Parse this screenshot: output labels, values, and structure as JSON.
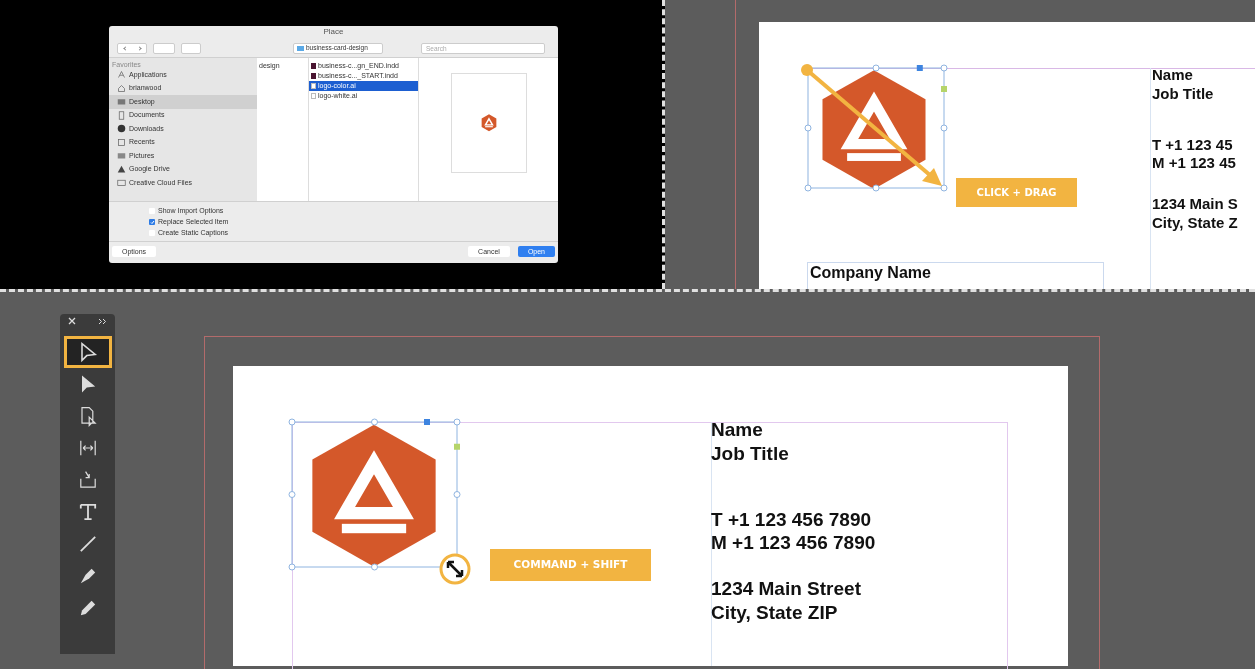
{
  "place_dialog": {
    "title": "Place",
    "location": "business-card-design",
    "search_placeholder": "Search",
    "sidebar": {
      "heading": "Favorites",
      "items": [
        {
          "label": "Applications",
          "selected": false
        },
        {
          "label": "brianwood",
          "selected": false
        },
        {
          "label": "Desktop",
          "selected": true
        },
        {
          "label": "Documents",
          "selected": false
        },
        {
          "label": "Downloads",
          "selected": false
        },
        {
          "label": "Recents",
          "selected": false
        },
        {
          "label": "Pictures",
          "selected": false
        },
        {
          "label": "Google Drive",
          "selected": false
        },
        {
          "label": "Creative Cloud Files",
          "selected": false
        }
      ]
    },
    "folder_column": [
      {
        "label": "design",
        "selected": false
      }
    ],
    "files": [
      {
        "name": "business-c...gn_END.indd",
        "kind": "indd",
        "selected": false
      },
      {
        "name": "business-c..._START.indd",
        "kind": "indd",
        "selected": false
      },
      {
        "name": "logo-color.ai",
        "kind": "ai",
        "selected": true
      },
      {
        "name": "logo-white.ai",
        "kind": "ai",
        "selected": false
      }
    ],
    "options": [
      {
        "label": "Show Import Options",
        "checked": false
      },
      {
        "label": "Replace Selected Item",
        "checked": true
      },
      {
        "label": "Create Static Captions",
        "checked": false
      }
    ],
    "options_button": "Options",
    "buttons": [
      {
        "label": "Cancel",
        "kind": "secondary"
      },
      {
        "label": "Open",
        "kind": "primary"
      }
    ]
  },
  "top_document": {
    "callout": "CLICK + DRAG",
    "text_groups": [
      [
        "Name",
        "Job Title"
      ],
      [
        "T +1 123 45",
        "M +1 123 45"
      ],
      [
        "1234 Main S",
        "City, State Z"
      ]
    ],
    "company": "Company Name"
  },
  "tools_panel": {
    "tools": [
      {
        "kind": "selection",
        "selected": true
      },
      {
        "kind": "direct",
        "selected": false
      },
      {
        "kind": "page",
        "selected": false
      },
      {
        "kind": "gap",
        "selected": false
      },
      {
        "kind": "collector",
        "selected": false
      },
      {
        "kind": "type",
        "selected": false
      },
      {
        "kind": "line",
        "selected": false
      },
      {
        "kind": "pen",
        "selected": false
      },
      {
        "kind": "pencil",
        "selected": false
      }
    ]
  },
  "bottom_document": {
    "callout": "COMMAND + SHIFT",
    "text_groups": [
      [
        "Name",
        "Job Title"
      ],
      [
        "T  +1 123 456 7890",
        "M +1 123 456 7890"
      ],
      [
        "1234 Main Street",
        "City, State ZIP"
      ]
    ]
  }
}
